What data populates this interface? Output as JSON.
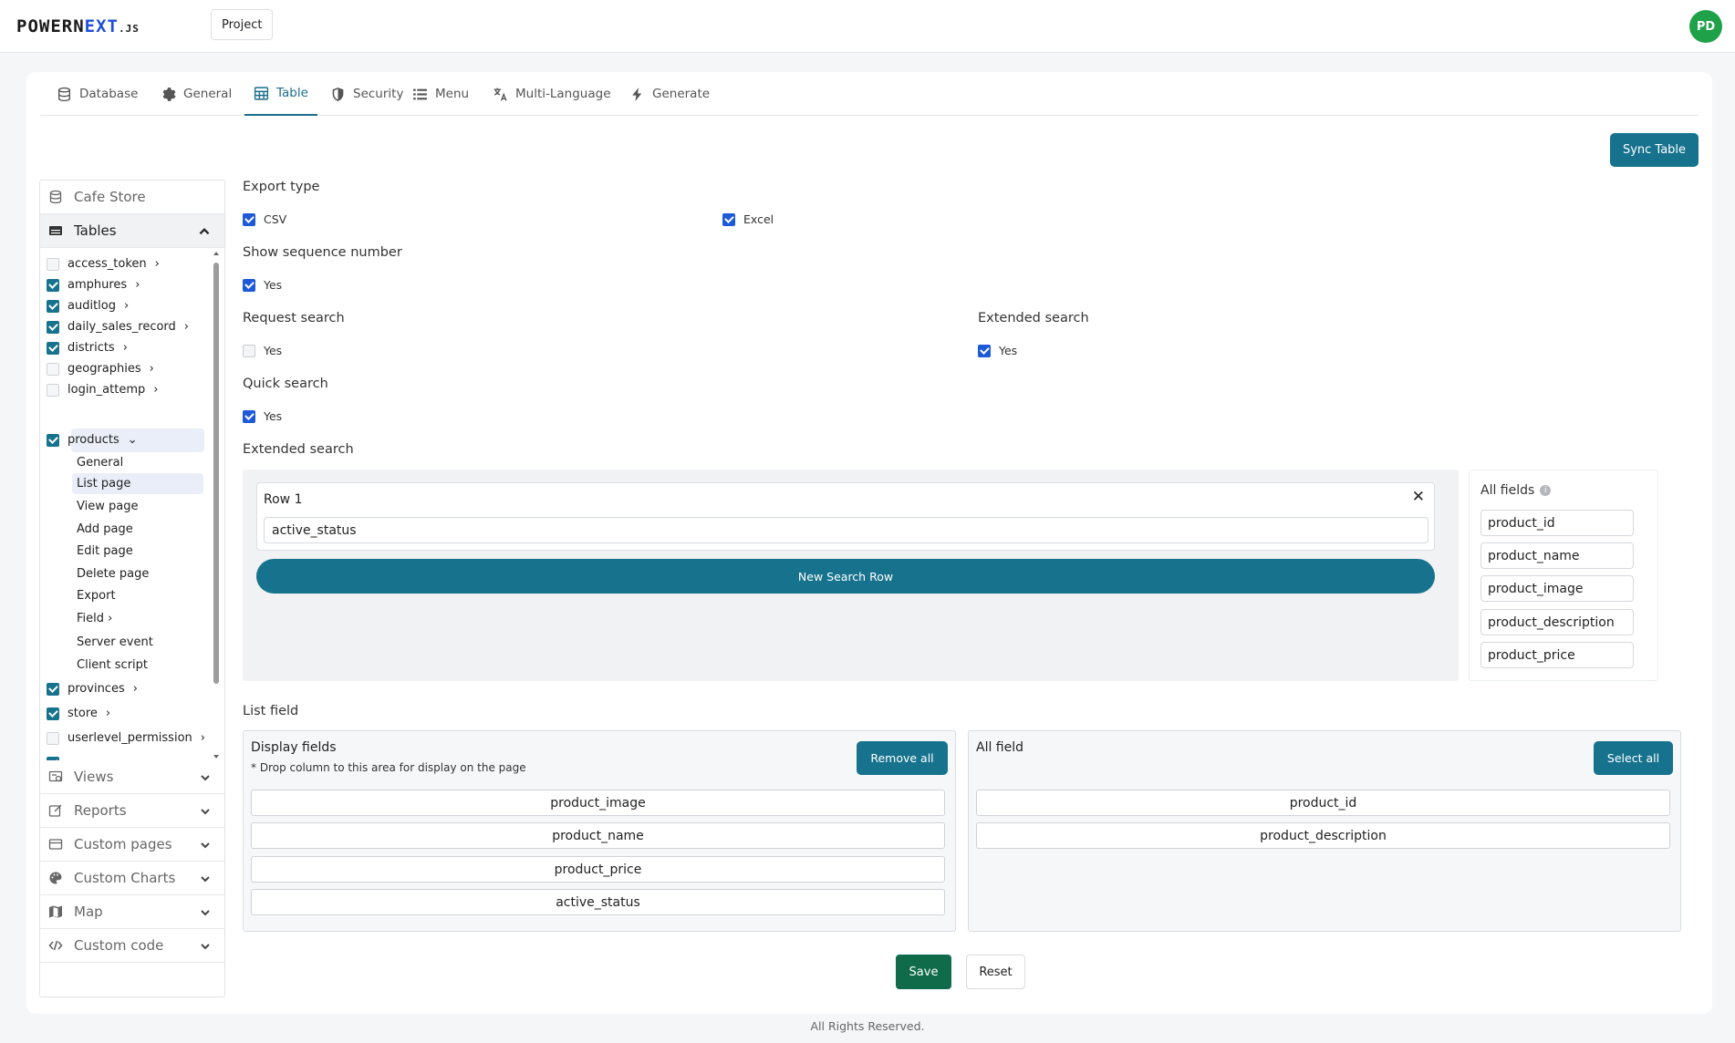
{
  "header": {
    "logo_main": "POWERN",
    "logo_accent": "EXT",
    "logo_suffix": ".JS",
    "project_label": "Project",
    "avatar_initials": "PD"
  },
  "tabs": [
    {
      "label": "Database",
      "icon": "database-icon"
    },
    {
      "label": "General",
      "icon": "gear-icon"
    },
    {
      "label": "Table",
      "icon": "table-icon",
      "active": true
    },
    {
      "label": "Security",
      "icon": "shield-icon"
    },
    {
      "label": "Menu",
      "icon": "list-icon"
    },
    {
      "label": "Multi-Language",
      "icon": "translate-icon"
    },
    {
      "label": "Generate",
      "icon": "bolt-icon"
    }
  ],
  "sync_label": "Sync Table",
  "sidebar": {
    "database_name": "Cafe Store",
    "tables_label": "Tables",
    "tables": [
      {
        "name": "access_token",
        "checked": false,
        "arrow": "›"
      },
      {
        "name": "amphures",
        "checked": true,
        "arrow": "›"
      },
      {
        "name": "auditlog",
        "checked": true,
        "arrow": "›"
      },
      {
        "name": "daily_sales_record",
        "checked": true,
        "arrow": "›"
      },
      {
        "name": "districts",
        "checked": true,
        "arrow": "›"
      },
      {
        "name": "geographies",
        "checked": false,
        "arrow": "›"
      },
      {
        "name": "login_attemp",
        "checked": false,
        "arrow": "›"
      },
      {
        "name": "products",
        "checked": true,
        "arrow": "⌄"
      },
      {
        "name": "provinces",
        "checked": true,
        "arrow": "›"
      },
      {
        "name": "store",
        "checked": true,
        "arrow": "›"
      },
      {
        "name": "userlevel_permission",
        "checked": false,
        "arrow": "›"
      }
    ],
    "product_pages": [
      "General",
      "List page",
      "View page",
      "Add page",
      "Edit page",
      "Delete page",
      "Export",
      "Field ›",
      "Server event",
      "Client script"
    ],
    "sections": [
      "Views",
      "Reports",
      "Custom pages",
      "Custom Charts",
      "Map",
      "Custom code"
    ]
  },
  "form": {
    "export_type_label": "Export type",
    "export_csv": "CSV",
    "export_excel": "Excel",
    "show_seq_label": "Show sequence number",
    "show_seq_yes": "Yes",
    "request_search_label": "Request search",
    "request_search_yes": "Yes",
    "extended_search_label": "Extended search",
    "extended_search_yes": "Yes",
    "quick_search_label": "Quick search",
    "quick_search_yes": "Yes",
    "extended_search_section": "Extended search",
    "search_row_title": "Row 1",
    "search_row_value": "active_status",
    "new_search_row": "New Search Row",
    "all_fields_title": "All fields",
    "all_fields": [
      "product_id",
      "product_name",
      "product_image",
      "product_description",
      "product_price"
    ],
    "list_field_label": "List field",
    "display_fields_title": "Display fields",
    "display_fields_note": "* Drop column to this area for display on the page",
    "remove_all": "Remove all",
    "display_fields": [
      "product_image",
      "product_name",
      "product_price",
      "active_status"
    ],
    "all_field_title": "All field",
    "select_all": "Select all",
    "available_fields": [
      "product_id",
      "product_description"
    ],
    "save": "Save",
    "reset": "Reset"
  },
  "footer": "All Rights Reserved."
}
